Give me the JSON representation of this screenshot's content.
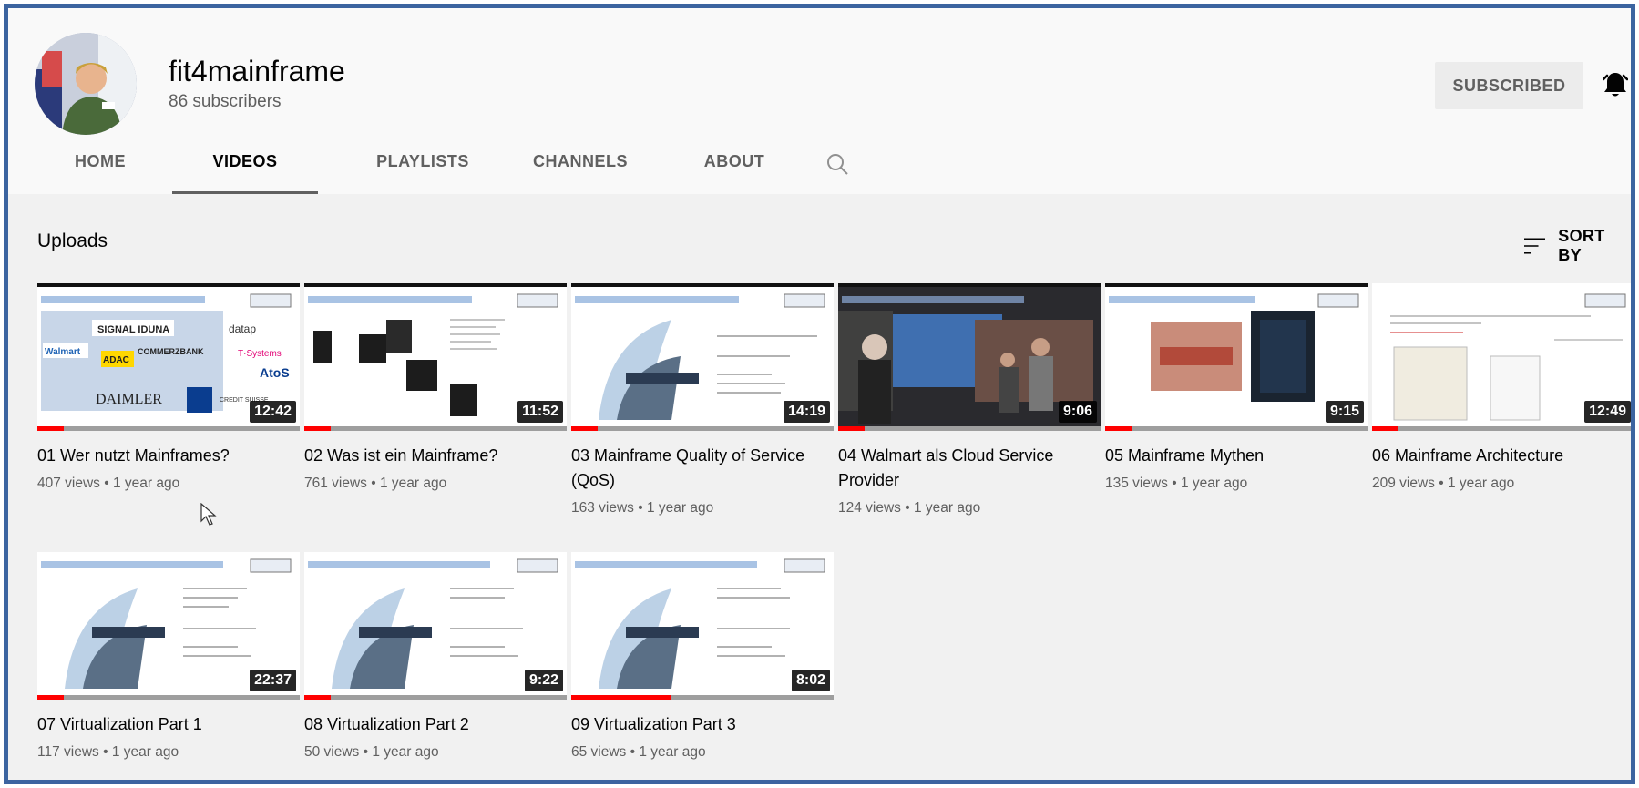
{
  "channel": {
    "name": "fit4mainframe",
    "subscribers": "86 subscribers",
    "subscribe_label": "SUBSCRIBED"
  },
  "tabs": [
    {
      "label": "HOME"
    },
    {
      "label": "VIDEOS"
    },
    {
      "label": "PLAYLISTS"
    },
    {
      "label": "CHANNELS"
    },
    {
      "label": "ABOUT"
    }
  ],
  "section": {
    "title": "Uploads",
    "sort_label": "SORT BY"
  },
  "icons": {
    "search": "search-icon",
    "bell": "notification-bell-icon",
    "sort": "sort-icon"
  },
  "colors": {
    "accent_red": "#ff0000",
    "frame_border": "#3c64a0",
    "header_bg": "#f9f9f9",
    "content_bg": "#f1f1f1"
  },
  "videos": [
    {
      "title": "01 Wer nutzt Mainframes?",
      "meta": "407 views • 1 year ago",
      "duration": "12:42",
      "watched": 0.1
    },
    {
      "title": "02 Was ist ein Mainframe?",
      "meta": "761 views • 1 year ago",
      "duration": "11:52",
      "watched": 0.1
    },
    {
      "title": "03 Mainframe Quality of Service (QoS)",
      "meta": "163 views • 1 year ago",
      "duration": "14:19",
      "watched": 0.1
    },
    {
      "title": "04 Walmart als Cloud Service Provider",
      "meta": "124 views • 1 year ago",
      "duration": "9:06",
      "watched": 0.1
    },
    {
      "title": "05 Mainframe Mythen",
      "meta": "135 views • 1 year ago",
      "duration": "9:15",
      "watched": 0.1
    },
    {
      "title": "06 Mainframe Architecture",
      "meta": "209 views • 1 year ago",
      "duration": "12:49",
      "watched": 0.1
    },
    {
      "title": "07 Virtualization Part 1",
      "meta": "117 views • 1 year ago",
      "duration": "22:37",
      "watched": 0.1
    },
    {
      "title": "08 Virtualization Part 2",
      "meta": "50 views • 1 year ago",
      "duration": "9:22",
      "watched": 0.1
    },
    {
      "title": "09 Virtualization Part 3",
      "meta": "65 views • 1 year ago",
      "duration": "8:02",
      "watched": 0.38
    }
  ]
}
